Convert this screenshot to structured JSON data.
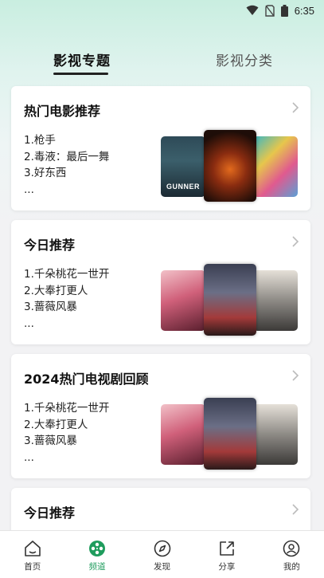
{
  "status_bar": {
    "time": "6:35"
  },
  "tabs": [
    {
      "label": "影视专题",
      "active": true
    },
    {
      "label": "影视分类",
      "active": false
    }
  ],
  "cards": [
    {
      "title": "热门电影推荐",
      "items": [
        "1.枪手",
        "2.毒液：最后一舞",
        "3.好东西",
        "..."
      ]
    },
    {
      "title": "今日推荐",
      "items": [
        "1.千朵桃花一世开",
        "2.大奉打更人",
        "3.蔷薇风暴",
        "..."
      ]
    },
    {
      "title": "2024热门电视剧回顾",
      "items": [
        "1.千朵桃花一世开",
        "2.大奉打更人",
        "3.蔷薇风暴",
        "..."
      ]
    },
    {
      "title": "今日推荐"
    }
  ],
  "posters": {
    "card1": [
      "GUNNER",
      "",
      ""
    ],
    "card2": [
      "",
      "",
      ""
    ],
    "card3": [
      "",
      "",
      ""
    ]
  },
  "bottom_nav": [
    {
      "label": "首页",
      "icon": "home-icon"
    },
    {
      "label": "频道",
      "icon": "film-reel-icon",
      "active": true
    },
    {
      "label": "发现",
      "icon": "compass-icon"
    },
    {
      "label": "分享",
      "icon": "share-icon"
    },
    {
      "label": "我的",
      "icon": "user-icon"
    }
  ],
  "colors": {
    "accent": "#1f9c5d",
    "background": "#f2f2f4"
  }
}
